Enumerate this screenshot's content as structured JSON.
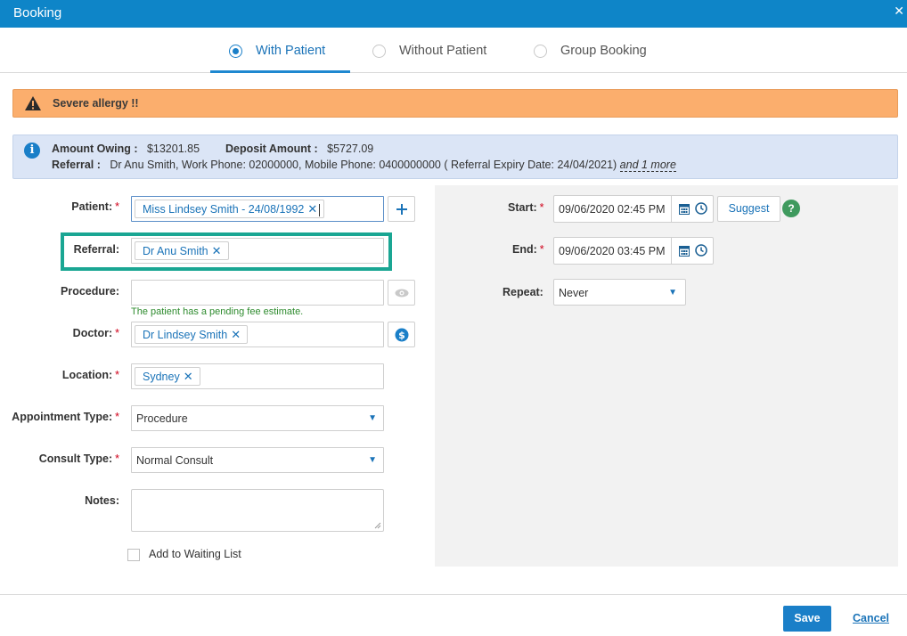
{
  "window": {
    "title": "Booking",
    "close_glyph": "✕"
  },
  "modes": [
    {
      "label": "With Patient",
      "selected": true
    },
    {
      "label": "Without Patient",
      "selected": false
    },
    {
      "label": "Group Booking",
      "selected": false
    }
  ],
  "alerts": {
    "warning": {
      "icon": "warning-triangle-icon",
      "text": "Severe allergy !!",
      "color": "#fbae6d"
    },
    "info": {
      "icon": "info-icon",
      "amount_owing_label": "Amount Owing :",
      "amount_owing_value": "$13201.85",
      "deposit_label": "Deposit Amount :",
      "deposit_value": "$5727.09",
      "referral_label": "Referral :",
      "referral_text": "Dr Anu Smith, Work Phone: 02000000, Mobile Phone: 0400000000 ( Referral Expiry Date: 24/04/2021)",
      "more_link": "and 1 more",
      "color": "#dbe5f6"
    }
  },
  "form": {
    "patient": {
      "label": "Patient:",
      "required_mark": "*",
      "tag": "Miss Lindsey Smith - 24/08/1992"
    },
    "referral": {
      "label": "Referral:",
      "tag": "Dr Anu Smith",
      "highlight_color": "#1aa693"
    },
    "procedure": {
      "label": "Procedure:",
      "value": "",
      "hint": "The patient has a pending fee estimate."
    },
    "doctor": {
      "label": "Doctor:",
      "required_mark": "*",
      "tag": "Dr Lindsey Smith"
    },
    "location": {
      "label": "Location:",
      "required_mark": "*",
      "tag": "Sydney"
    },
    "appointment_type": {
      "label": "Appointment Type:",
      "required_mark": "*",
      "value": "Procedure"
    },
    "consult_type": {
      "label": "Consult Type:",
      "required_mark": "*",
      "value": "Normal Consult"
    },
    "notes": {
      "label": "Notes:",
      "value": ""
    },
    "waiting_list": {
      "label": "Add to Waiting List",
      "checked": false
    }
  },
  "schedule": {
    "start": {
      "label": "Start:",
      "required_mark": "*",
      "value": "09/06/2020 02:45 PM"
    },
    "end": {
      "label": "End:",
      "required_mark": "*",
      "value": "09/06/2020 03:45 PM"
    },
    "suggest_label": "Suggest",
    "help_glyph": "?",
    "repeat": {
      "label": "Repeat:",
      "value": "Never"
    }
  },
  "footer": {
    "save_label": "Save",
    "cancel_label": "Cancel"
  },
  "colors": {
    "primary": "#0e85c8",
    "required": "#d0021b",
    "hint": "#2e8b2e",
    "help": "#3f9a5e"
  }
}
